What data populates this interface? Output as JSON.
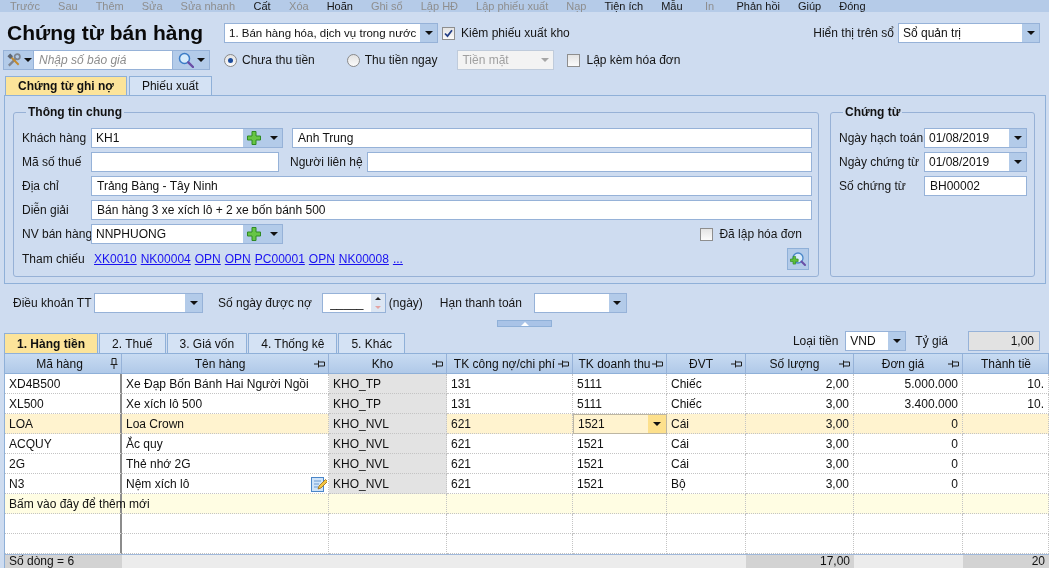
{
  "toolbar": [
    {
      "label": "Trước",
      "disabled": true
    },
    {
      "label": "Sau",
      "disabled": true
    },
    {
      "label": "Thêm",
      "disabled": true
    },
    {
      "label": "Sửa",
      "disabled": true
    },
    {
      "label": "Sửa nhanh",
      "disabled": true
    },
    {
      "label": "Cất",
      "disabled": false
    },
    {
      "label": "Xóa",
      "disabled": true
    },
    {
      "label": "Hoãn",
      "disabled": false
    },
    {
      "label": "Ghi sổ",
      "disabled": true
    },
    {
      "label": "Lập HĐ",
      "disabled": true
    },
    {
      "label": "Lập phiếu xuất",
      "disabled": true
    },
    {
      "label": "Nạp",
      "disabled": true
    },
    {
      "label": "Tiện ích",
      "disabled": false
    },
    {
      "label": "Mẫu",
      "disabled": false
    },
    {
      "label": "In",
      "disabled": true
    },
    {
      "label": "Phản hồi",
      "disabled": false
    },
    {
      "label": "Giúp",
      "disabled": false
    },
    {
      "label": "Đóng",
      "disabled": false
    }
  ],
  "header": {
    "title": "Chứng từ bán hàng",
    "sale_type": "1. Bán hàng hóa, dịch vụ trong nước",
    "export_slip": {
      "label": "Kiêm phiếu xuất kho",
      "checked": true
    },
    "ledger": {
      "label": "Hiển thị trên sổ",
      "value": "Sổ quản trị"
    }
  },
  "quote_search": {
    "placeholder": "Nhập số báo giá"
  },
  "payment": {
    "options": [
      {
        "label": "Chưa thu tiền",
        "selected": true
      },
      {
        "label": "Thu tiền ngay",
        "selected": false
      }
    ],
    "method": {
      "value": "Tiền mặt",
      "disabled": true
    },
    "with_invoice": {
      "label": "Lập kèm hóa đơn",
      "checked": false
    }
  },
  "tabs": [
    {
      "label": "Chứng từ ghi nợ",
      "selected": true
    },
    {
      "label": "Phiếu xuất",
      "selected": false
    }
  ],
  "general_info": {
    "title": "Thông tin chung",
    "customer": {
      "label": "Khách hàng",
      "code": "KH1",
      "name": "Anh Trung"
    },
    "tax_code": {
      "label": "Mã số thuế"
    },
    "contact": {
      "label": "Người liên hệ"
    },
    "address": {
      "label": "Địa chỉ",
      "value": "Trảng Bàng - Tây Ninh"
    },
    "description": {
      "label": "Diễn giải",
      "value": "Bán hàng 3 xe xích lô + 2 xe bốn bánh 500"
    },
    "salesperson": {
      "label": "NV bán hàng",
      "value": "NNPHUONG"
    },
    "invoiced": {
      "label": "Đã lập hóa đơn",
      "checked": false
    },
    "references": {
      "label": "Tham chiếu",
      "links": [
        "XK0010",
        "NK00004",
        "OPN",
        "OPN",
        "PC00001",
        "OPN",
        "NK00008",
        "..."
      ]
    }
  },
  "voucher": {
    "title": "Chứng từ",
    "posting_date": {
      "label": "Ngày hạch toán",
      "value": "01/08/2019"
    },
    "voucher_date": {
      "label": "Ngày chứng từ",
      "value": "01/08/2019"
    },
    "voucher_no": {
      "label": "Số chứng từ",
      "value": "BH00002"
    }
  },
  "terms": {
    "payment_terms": {
      "label": "Điều khoản TT"
    },
    "credit_days": {
      "label": "Số ngày được nợ",
      "value": "_____",
      "unit": "(ngày)"
    },
    "due_date": {
      "label": "Hạn thanh toán"
    }
  },
  "detail_tabs": [
    {
      "label": "1. Hàng tiền",
      "selected": true
    },
    {
      "label": "2. Thuế",
      "selected": false
    },
    {
      "label": "3. Giá vốn",
      "selected": false
    },
    {
      "label": "4. Thống kê",
      "selected": false
    },
    {
      "label": "5. Khác",
      "selected": false
    }
  ],
  "currency": {
    "label": "Loại tiền",
    "value": "VND"
  },
  "exchange_rate": {
    "label": "Tỷ giá",
    "value": "1,00"
  },
  "grid": {
    "columns": [
      {
        "label": "Mã hàng",
        "pinned": true
      },
      {
        "label": "Tên hàng",
        "pinned": false
      },
      {
        "label": "Kho",
        "pinned": false
      },
      {
        "label": "TK công nợ/chi phí",
        "pinned": false
      },
      {
        "label": "TK doanh thu",
        "pinned": false
      },
      {
        "label": "ĐVT",
        "pinned": false
      },
      {
        "label": "Số lượng",
        "pinned": false
      },
      {
        "label": "Đơn giá",
        "pinned": false
      },
      {
        "label": "Thành tiề"
      }
    ],
    "rows": [
      {
        "cells": [
          "XD4B500",
          "Xe Đạp Bốn Bánh Hai Người Ngồi",
          "KHO_TP",
          "131",
          "5111",
          "Chiếc",
          "2,00",
          "5.000.000",
          "10."
        ],
        "selected": false,
        "cell_editor": false,
        "memo_icon": false
      },
      {
        "cells": [
          "XL500",
          "Xe xích lô 500",
          "KHO_TP",
          "131",
          "5111",
          "Chiếc",
          "3,00",
          "3.400.000",
          "10."
        ],
        "selected": false,
        "cell_editor": false,
        "memo_icon": false
      },
      {
        "cells": [
          "LOA",
          "Loa Crown",
          "KHO_NVL",
          "621",
          "1521",
          "Cái",
          "3,00",
          "0"
        ],
        "selected": true,
        "cell_editor": true,
        "memo_icon": false
      },
      {
        "cells": [
          "ACQUY",
          "Ắc quy",
          "KHO_NVL",
          "621",
          "1521",
          "Cái",
          "3,00",
          "0"
        ],
        "selected": false,
        "cell_editor": false,
        "memo_icon": false
      },
      {
        "cells": [
          "2G",
          "Thẻ nhớ 2G",
          "KHO_NVL",
          "621",
          "1521",
          "Cái",
          "3,00",
          "0"
        ],
        "selected": false,
        "cell_editor": false,
        "memo_icon": false
      },
      {
        "cells": [
          "N3",
          "Nệm xích lô",
          "KHO_NVL",
          "621",
          "1521",
          "Bộ",
          "3,00",
          "0"
        ],
        "selected": false,
        "cell_editor": false,
        "memo_icon": true
      }
    ],
    "new_row_prompt": "Bấm vào đây để thêm mới",
    "footer": {
      "row_count": "Số dòng = 6",
      "quantity_total": "17,00",
      "amount_total": "20"
    }
  }
}
